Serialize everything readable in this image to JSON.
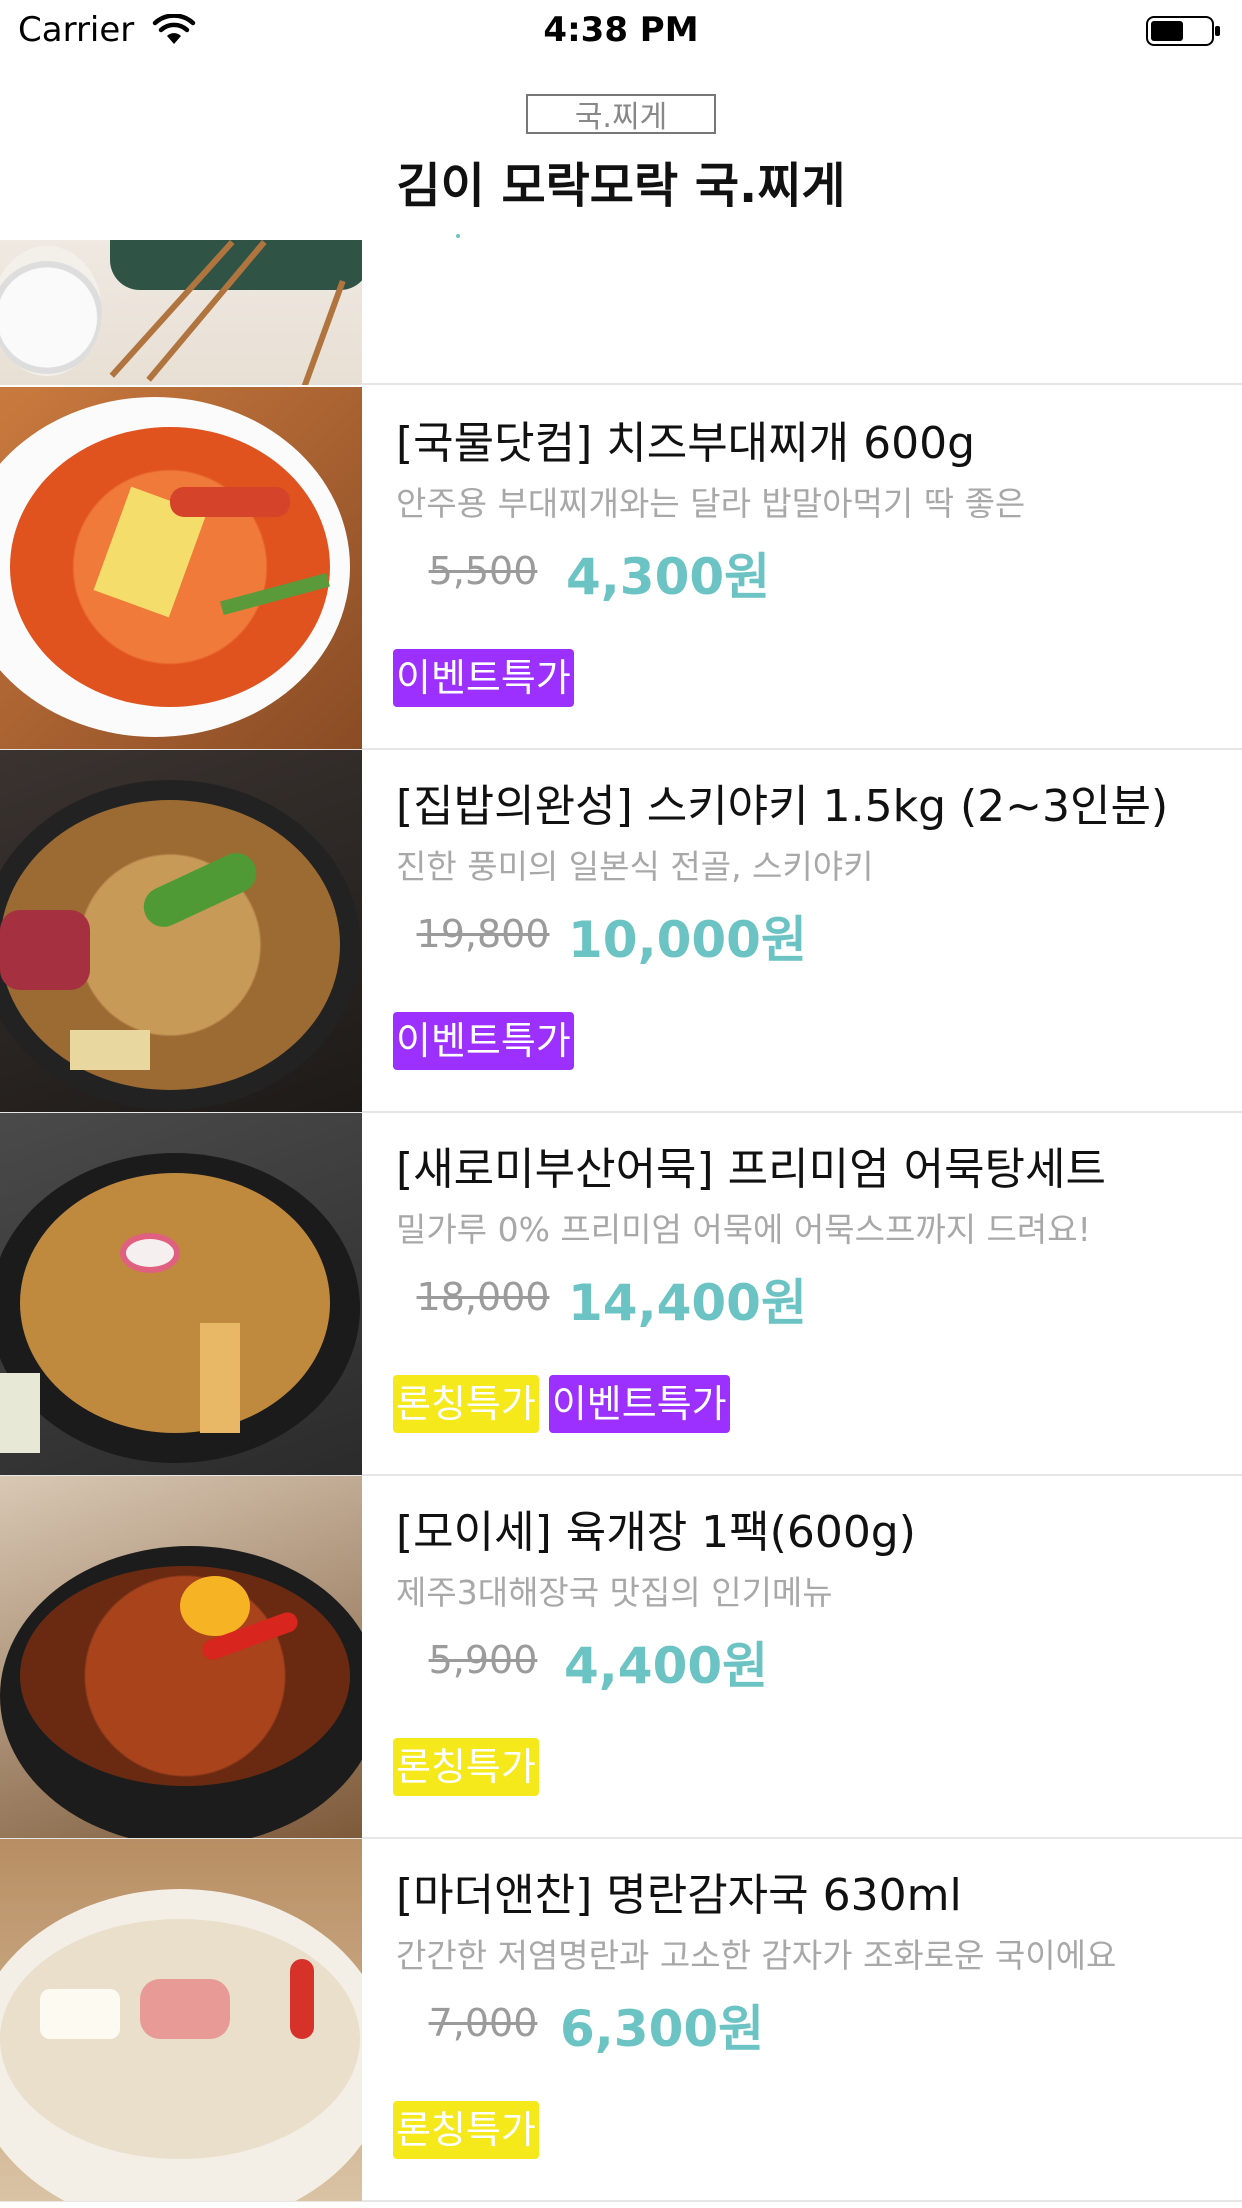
{
  "status_bar": {
    "carrier": "Carrier",
    "time": "4:38 PM"
  },
  "header": {
    "category": "국.찌게",
    "title": "김이 모락모락 국.찌게"
  },
  "colors": {
    "accent": "#6cc3c3",
    "badge_event": "#9b30ff",
    "badge_launch": "#f5e91c"
  },
  "products": [
    {
      "name": "[국물닷컴] 치즈부대찌개 600g",
      "description": "안주용 부대찌개와는 달라 밥말아먹기 딱 좋은",
      "original_price": "5,500",
      "sale_price": "4,300원",
      "badges": [
        {
          "label": "이벤트특가",
          "kind": "event"
        }
      ],
      "image_icon": "cheese-budae-jjigae-photo"
    },
    {
      "name": "[집밥의완성] 스키야키 1.5kg (2~3인분)",
      "description": "진한 풍미의 일본식 전골, 스키야키",
      "original_price": "19,800",
      "sale_price": "10,000원",
      "badges": [
        {
          "label": "이벤트특가",
          "kind": "event"
        }
      ],
      "image_icon": "sukiyaki-photo"
    },
    {
      "name": "[새로미부산어묵] 프리미엄 어묵탕세트",
      "description": "밀가루 0% 프리미엄 어묵에 어묵스프까지 드려요!",
      "original_price": "18,000",
      "sale_price": "14,400원",
      "badges": [
        {
          "label": "론칭특가",
          "kind": "launch"
        },
        {
          "label": "이벤트특가",
          "kind": "event"
        }
      ],
      "image_icon": "fishcake-soup-photo"
    },
    {
      "name": "[모이세] 육개장 1팩(600g)",
      "description": "제주3대해장국 맛집의 인기메뉴",
      "original_price": "5,900",
      "sale_price": "4,400원",
      "badges": [
        {
          "label": "론칭특가",
          "kind": "launch"
        }
      ],
      "image_icon": "yukgaejang-photo"
    },
    {
      "name": "[마더앤찬] 명란감자국 630ml",
      "description": "간간한 저염명란과 고소한 감자가 조화로운 국이에요",
      "original_price": "7,000",
      "sale_price": "6,300원",
      "badges": [
        {
          "label": "론칭특가",
          "kind": "launch"
        }
      ],
      "image_icon": "pollack-roe-potato-soup-photo"
    }
  ]
}
